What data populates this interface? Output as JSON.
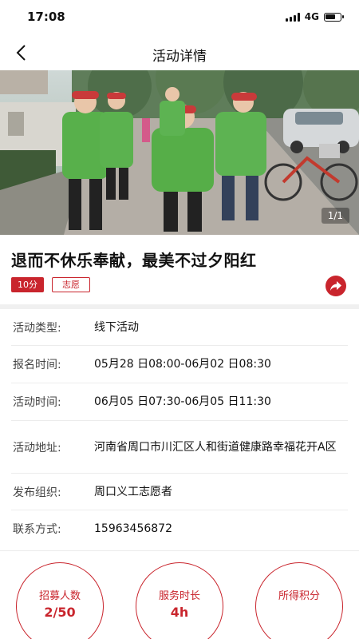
{
  "status_bar": {
    "time": "17:08",
    "network": "4G",
    "battery_level": 0.7
  },
  "nav": {
    "title": "活动详情"
  },
  "hero": {
    "counter": "1/1"
  },
  "activity": {
    "title": "退而不休乐奉献，最美不过夕阳红",
    "points_tag": "10分",
    "type_tag": "志愿"
  },
  "details": [
    {
      "label": "活动类型:",
      "value": "线下活动"
    },
    {
      "label": "报名时间:",
      "value": "05月28 日08:00-06月02 日08:30"
    },
    {
      "label": "活动时间:",
      "value": "06月05 日07:30-06月05 日11:30"
    },
    {
      "label": "活动地址:",
      "value": "河南省周口市川汇区人和街道健康路幸福花开A区"
    },
    {
      "label": "发布组织:",
      "value": "周口义工志愿者"
    },
    {
      "label": "联系方式:",
      "value": "15963456872"
    }
  ],
  "stats": [
    {
      "label": "招募人数",
      "value": "2/50"
    },
    {
      "label": "服务时长",
      "value": "4h"
    },
    {
      "label": "所得积分",
      "value": ""
    }
  ],
  "colors": {
    "accent": "#c9252d",
    "divider": "#f0f0f0"
  },
  "icons": {
    "back": "chevron-left-icon",
    "share": "share-icon"
  }
}
